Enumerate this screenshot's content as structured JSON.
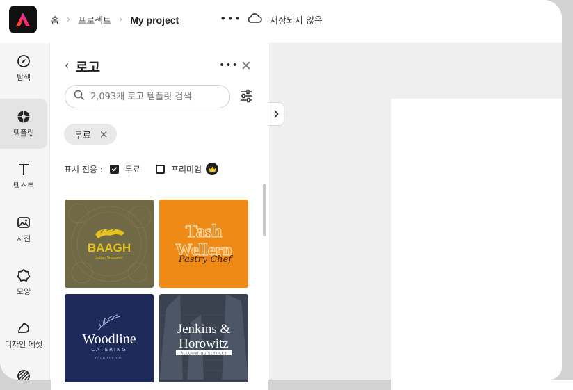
{
  "topbar": {
    "breadcrumbs": [
      "홈",
      "프로젝트"
    ],
    "project_name": "My project",
    "more_label": "•••",
    "save_status": "저장되지 않음"
  },
  "rail": {
    "items": [
      {
        "label": "탐색",
        "icon": "compass-icon"
      },
      {
        "label": "템플릿",
        "icon": "templates-icon"
      },
      {
        "label": "텍스트",
        "icon": "text-icon"
      },
      {
        "label": "사진",
        "icon": "photo-icon"
      },
      {
        "label": "모양",
        "icon": "shape-icon"
      },
      {
        "label": "디자인 에셋",
        "icon": "design-assets-icon"
      }
    ],
    "active_index": 1
  },
  "panel": {
    "title": "로고",
    "more_label": "•••",
    "close_label": "✕",
    "search_placeholder": "2,093개 로고 템플릿 검색",
    "chip_label": "무료",
    "chip_remove": "×",
    "show_only_label": "표시 전용 :",
    "option_free": "무료",
    "option_free_checked": true,
    "option_premium": "프리미엄",
    "option_premium_checked": false
  },
  "templates": [
    {
      "brand": "BAAGH",
      "tagline": "Indian Takeaway",
      "bg": "#6f6a45",
      "fg": "#e7c21e"
    },
    {
      "brand_line1": "Tash",
      "brand_line2": "Wellern",
      "script": "Pastry Chef",
      "bg": "#ef8a17",
      "fg": "#f6d7a2"
    },
    {
      "brand": "Woodline",
      "sub": "CATERING",
      "tagline": "FOOD FOR YOU",
      "bg": "#1e2a5a",
      "fg": "#ffffff"
    },
    {
      "brand_line1": "Jenkins &",
      "brand_line2": "Horowitz",
      "sub": "ACCOUNTING SERVICES",
      "bg": "#3a4250",
      "fg": "#ffffff"
    }
  ],
  "colors": {
    "accent_red": "#eb1000",
    "rail_bg": "#f5f5f5",
    "active_bg": "#e4e4e4"
  }
}
